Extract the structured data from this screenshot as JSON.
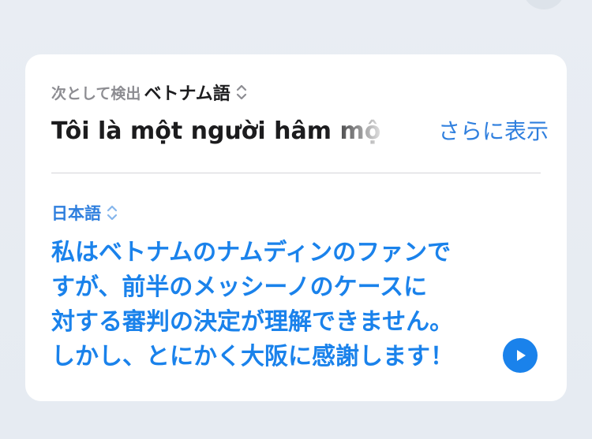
{
  "detected": {
    "prefix": "次として検出",
    "language": "ベトナム語"
  },
  "source": {
    "text": "Tôi là một người hâm mộ đội Việt Nam Định",
    "more_label": "さらに表示"
  },
  "target": {
    "language": "日本語",
    "lines": [
      "私はベトナムのナムディンのファンで",
      "すが、前半のメッシーノのケースに",
      "対する審判の決定が理解できません。",
      "しかし、とにかく大阪に感謝します！"
    ]
  },
  "icons": {
    "language_chevron": "chevron-up-down-icon",
    "play": "play-icon"
  },
  "colors": {
    "accent": "#1a82eb",
    "link": "#2f7fde",
    "text": "#1c1c1e",
    "secondary": "#8d8d92"
  }
}
